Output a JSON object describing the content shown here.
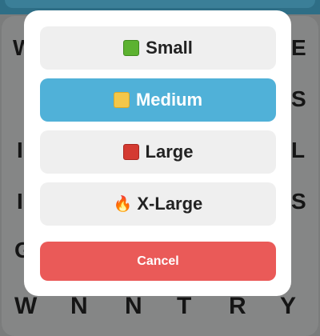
{
  "background_letters": {
    "left": [
      "W",
      "I",
      "I",
      "G"
    ],
    "right": [
      "E",
      "S",
      "L",
      "S"
    ],
    "bottom_row": [
      "W",
      "N",
      "N",
      "T",
      "R",
      "Y"
    ]
  },
  "size_dialog": {
    "options": [
      {
        "label": "Small",
        "icon": "green-square-icon",
        "color": "#5cb230"
      },
      {
        "label": "Medium",
        "icon": "yellow-square-icon",
        "color": "#f4c74a",
        "selected": true
      },
      {
        "label": "Large",
        "icon": "red-square-icon",
        "color": "#d43a31"
      },
      {
        "label": "X-Large",
        "icon": "fire-icon"
      }
    ],
    "cancel_label": "Cancel"
  },
  "colors": {
    "selected": "#50b1d8",
    "cancel": "#ea5a58",
    "option_bg": "#efefef"
  }
}
